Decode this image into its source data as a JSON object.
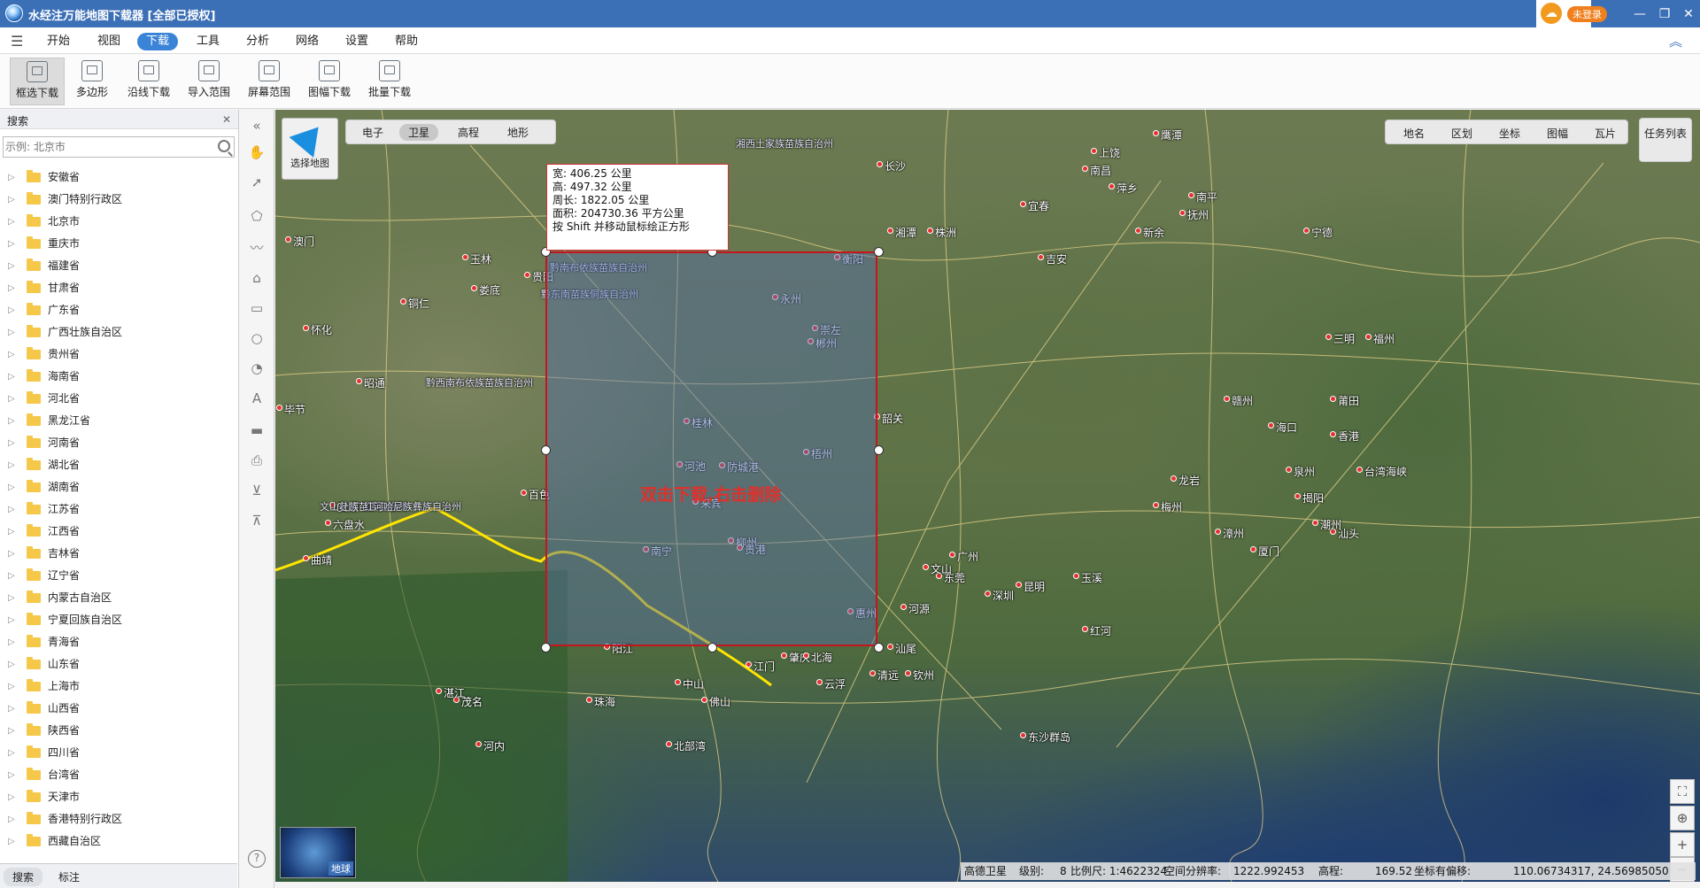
{
  "window": {
    "title": "水经注万能地图下载器 [全部已授权]",
    "login_badge": "未登录",
    "min": "—",
    "restore": "❐",
    "close": "✕"
  },
  "menu": {
    "items": [
      "开始",
      "视图",
      "下载",
      "工具",
      "分析",
      "网络",
      "设置",
      "帮助"
    ],
    "active": "下载"
  },
  "toolbar": {
    "items": [
      "框选下载",
      "多边形",
      "沿线下载",
      "导入范围",
      "屏幕范围",
      "图幅下载",
      "批量下载"
    ],
    "active": "框选下载"
  },
  "sidebar": {
    "title": "搜索",
    "search_placeholder": "示例: 北京市",
    "provinces": [
      "安徽省",
      "澳门特别行政区",
      "北京市",
      "重庆市",
      "福建省",
      "甘肃省",
      "广东省",
      "广西壮族自治区",
      "贵州省",
      "海南省",
      "河北省",
      "黑龙江省",
      "河南省",
      "湖北省",
      "湖南省",
      "江苏省",
      "江西省",
      "吉林省",
      "辽宁省",
      "内蒙古自治区",
      "宁夏回族自治区",
      "青海省",
      "山东省",
      "上海市",
      "山西省",
      "陕西省",
      "四川省",
      "台湾省",
      "天津市",
      "香港特别行政区",
      "西藏自治区"
    ],
    "tabs": [
      "搜索",
      "标注"
    ]
  },
  "map": {
    "tabs": [
      "电子",
      "卫星",
      "高程",
      "地形"
    ],
    "active_tab": "卫星",
    "layer_tabs": [
      "地名",
      "区划",
      "坐标",
      "图幅",
      "瓦片"
    ],
    "task_list": "任务列表",
    "select_map": "选择地图",
    "globe_label": "地球",
    "selection": {
      "width": "宽:  406.25 公里",
      "height": "高:  497.32 公里",
      "perimeter": "周长:  1822.05 公里",
      "area": "面积:  204730.36 平方公里",
      "hint": "按 Shift 并移动鼠标绘正方形",
      "action": "双击下载,右击删除"
    },
    "cities": [
      "贵阳",
      "南宁",
      "柳州",
      "河池",
      "百色",
      "来宾",
      "贵港",
      "广州",
      "深圳",
      "东莞",
      "长沙",
      "株洲",
      "湘潭",
      "衡阳",
      "永州",
      "郴州",
      "桂林",
      "梧州",
      "韶关",
      "赣州",
      "吉安",
      "萍乡",
      "新余",
      "宜春",
      "抚州",
      "南昌",
      "三明",
      "龙岩",
      "梅州",
      "揭阳",
      "汕头",
      "潮州",
      "漳州",
      "厦门",
      "泉州",
      "莆田",
      "福州",
      "宁德",
      "南平",
      "上饶",
      "鹰潭",
      "益阳",
      "娄底",
      "怀化",
      "铜仁",
      "昭通",
      "毕节",
      "安顺",
      "六盘水",
      "曲靖",
      "昆明",
      "玉溪",
      "红河",
      "文山",
      "河源",
      "惠州",
      "汕尾",
      "清远",
      "云浮",
      "肇庆",
      "江门",
      "佛山",
      "中山",
      "珠海",
      "阳江",
      "茂名",
      "湛江",
      "北海",
      "钦州",
      "防城港",
      "崇左",
      "玉林",
      "澳门",
      "香港",
      "海口",
      "台湾海峡",
      "东沙群岛",
      "北部湾",
      "河内"
    ],
    "regions": [
      "黔南布依族苗族自治州",
      "黔东南苗族侗族自治州",
      "黔西南布依族苗族自治州",
      "文山壮族苗族自治州",
      "红河哈尼族彝族自治州",
      "湘西土家族苗族自治州"
    ]
  },
  "status": {
    "source": "高德卫星",
    "level_label": "级别:",
    "level": "8",
    "scale": "比例尺: 1:4622324",
    "resolution_label": "空间分辨率:",
    "resolution": "1222.992453",
    "elevation_label": "高程:",
    "elevation": "169.52",
    "coord_label": "坐标有偏移:",
    "coords": "110.06734317, 24.56985050"
  }
}
